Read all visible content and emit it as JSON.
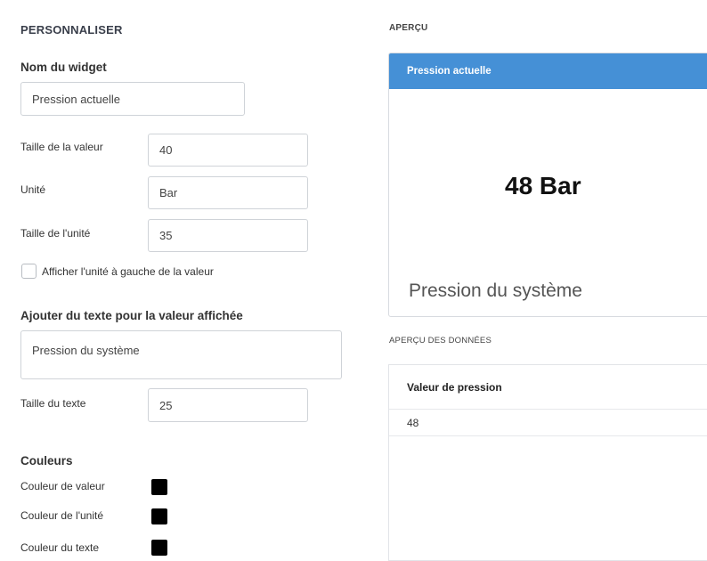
{
  "settings": {
    "title": "PERSONNALISER",
    "widget_name_label": "Nom du widget",
    "widget_name_value": "Pression actuelle",
    "value_size_label": "Taille de la valeur",
    "value_size_value": "40",
    "unit_label": "Unité",
    "unit_value": "Bar",
    "unit_size_label": "Taille de l'unité",
    "unit_size_value": "35",
    "unit_left_checkbox_label": "Afficher l'unité à gauche de la valeur",
    "unit_left_checked": false,
    "display_text_label": "Ajouter du texte pour la valeur affichée",
    "display_text_value": "Pression du système",
    "text_size_label": "Taille du texte",
    "text_size_value": "25",
    "colors_title": "Couleurs",
    "value_color_label": "Couleur de valeur",
    "unit_color_label": "Couleur de l'unité",
    "text_color_label": "Couleur du texte",
    "value_color": "#000000",
    "unit_color": "#000000",
    "text_color": "#000000"
  },
  "preview": {
    "title": "APERÇU",
    "widget_header": "Pression actuelle",
    "big_value": "48 Bar",
    "caption": "Pression du système",
    "header_color": "#4590d6"
  },
  "data_preview": {
    "title": "APERÇU DES DONNÉES",
    "column_header": "Valeur de pression",
    "rows": [
      "48"
    ]
  }
}
